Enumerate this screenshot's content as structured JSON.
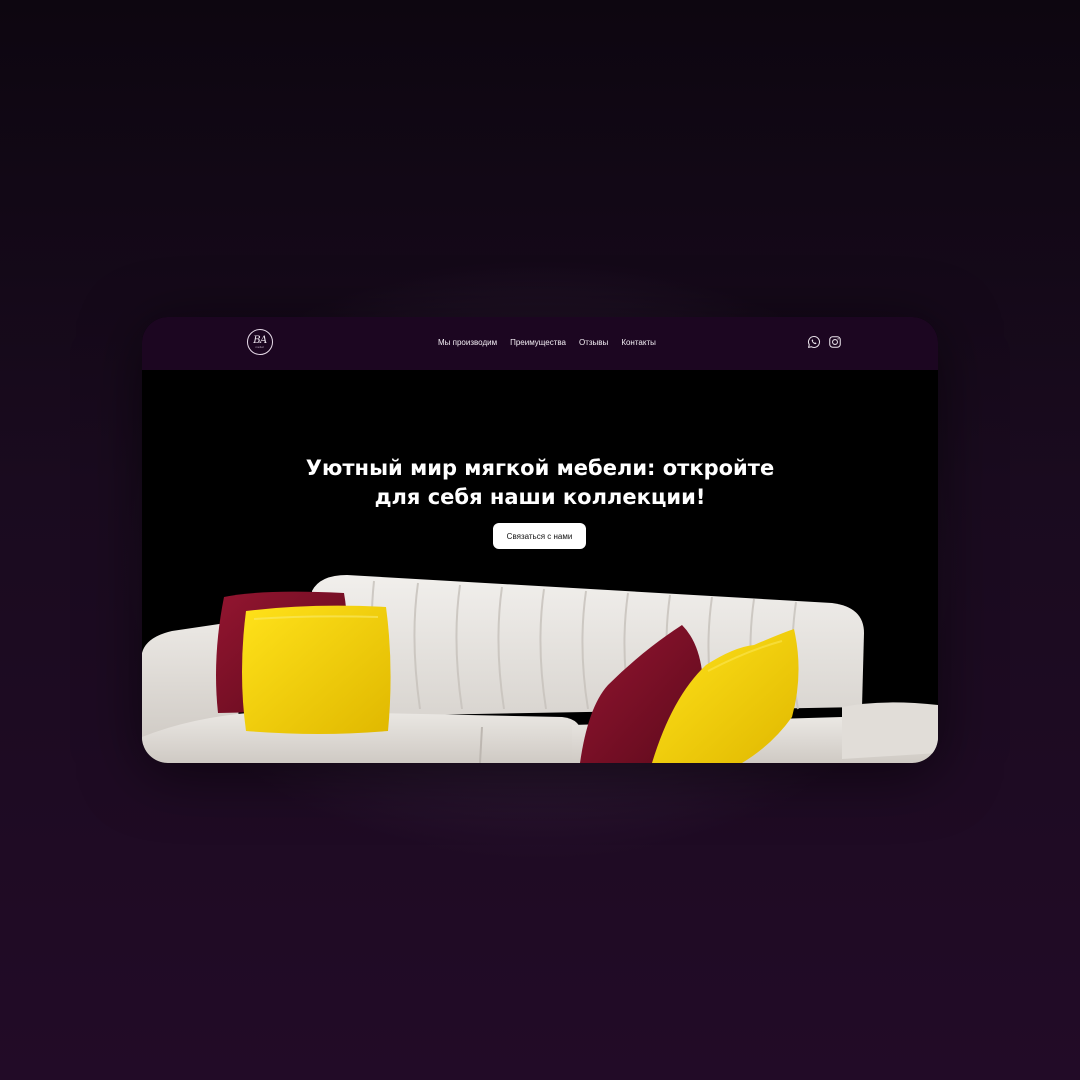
{
  "header": {
    "logo_text": "BA",
    "logo_subtext": "mebel",
    "nav": [
      {
        "label": "Мы производим"
      },
      {
        "label": "Преимущества"
      },
      {
        "label": "Отзывы"
      },
      {
        "label": "Контакты"
      }
    ],
    "socials": [
      {
        "icon": "whatsapp-icon"
      },
      {
        "icon": "instagram-icon"
      }
    ]
  },
  "hero": {
    "title_line1": "Уютный мир мягкой мебели: откройте",
    "title_line2": "для себя наши коллекции!",
    "cta_label": "Связаться с нами",
    "image": "white-sofa-with-burgundy-and-yellow-pillows"
  },
  "colors": {
    "header_bg": "#1c0621",
    "hero_bg": "#000000",
    "page_bg": "#1a0b1f",
    "pillow_yellow": "#f2cf06",
    "pillow_burgundy": "#7a0f26",
    "sofa": "#e9e6e2"
  }
}
